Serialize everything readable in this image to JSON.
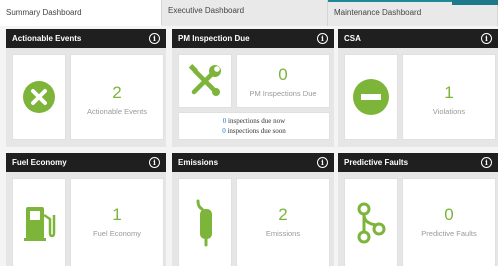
{
  "tabs": [
    "Summary Dashboard",
    "Executive Dashboard",
    "Maintenance Dashboard"
  ],
  "info_glyph": "i",
  "panels": {
    "actionable": {
      "title": "Actionable Events",
      "value": "2",
      "label": "Actionable Events",
      "icon": "x-circle-icon"
    },
    "pm": {
      "title": "PM Inspection Due",
      "value": "0",
      "label": "PM Inspections Due",
      "icon": "wrench-screwdriver-icon",
      "now_count": "0",
      "now_text": " inspections due now",
      "soon_count": "0",
      "soon_text": " inspections due soon"
    },
    "csa": {
      "title": "CSA",
      "value": "1",
      "label": "Violations",
      "icon": "minus-circle-icon"
    },
    "fuel": {
      "title": "Fuel Economy",
      "value": "1",
      "label": "Fuel Economy",
      "icon": "fuel-pump-icon"
    },
    "emissions": {
      "title": "Emissions",
      "value": "2",
      "label": "Emissions",
      "icon": "exhaust-icon"
    },
    "faults": {
      "title": "Predictive Faults",
      "value": "0",
      "label": "Predictive Faults",
      "icon": "branch-icon"
    }
  },
  "colors": {
    "accent_green": "#7db43a",
    "header": "#1f1f1f",
    "tab_accent": "#1e8a96"
  }
}
